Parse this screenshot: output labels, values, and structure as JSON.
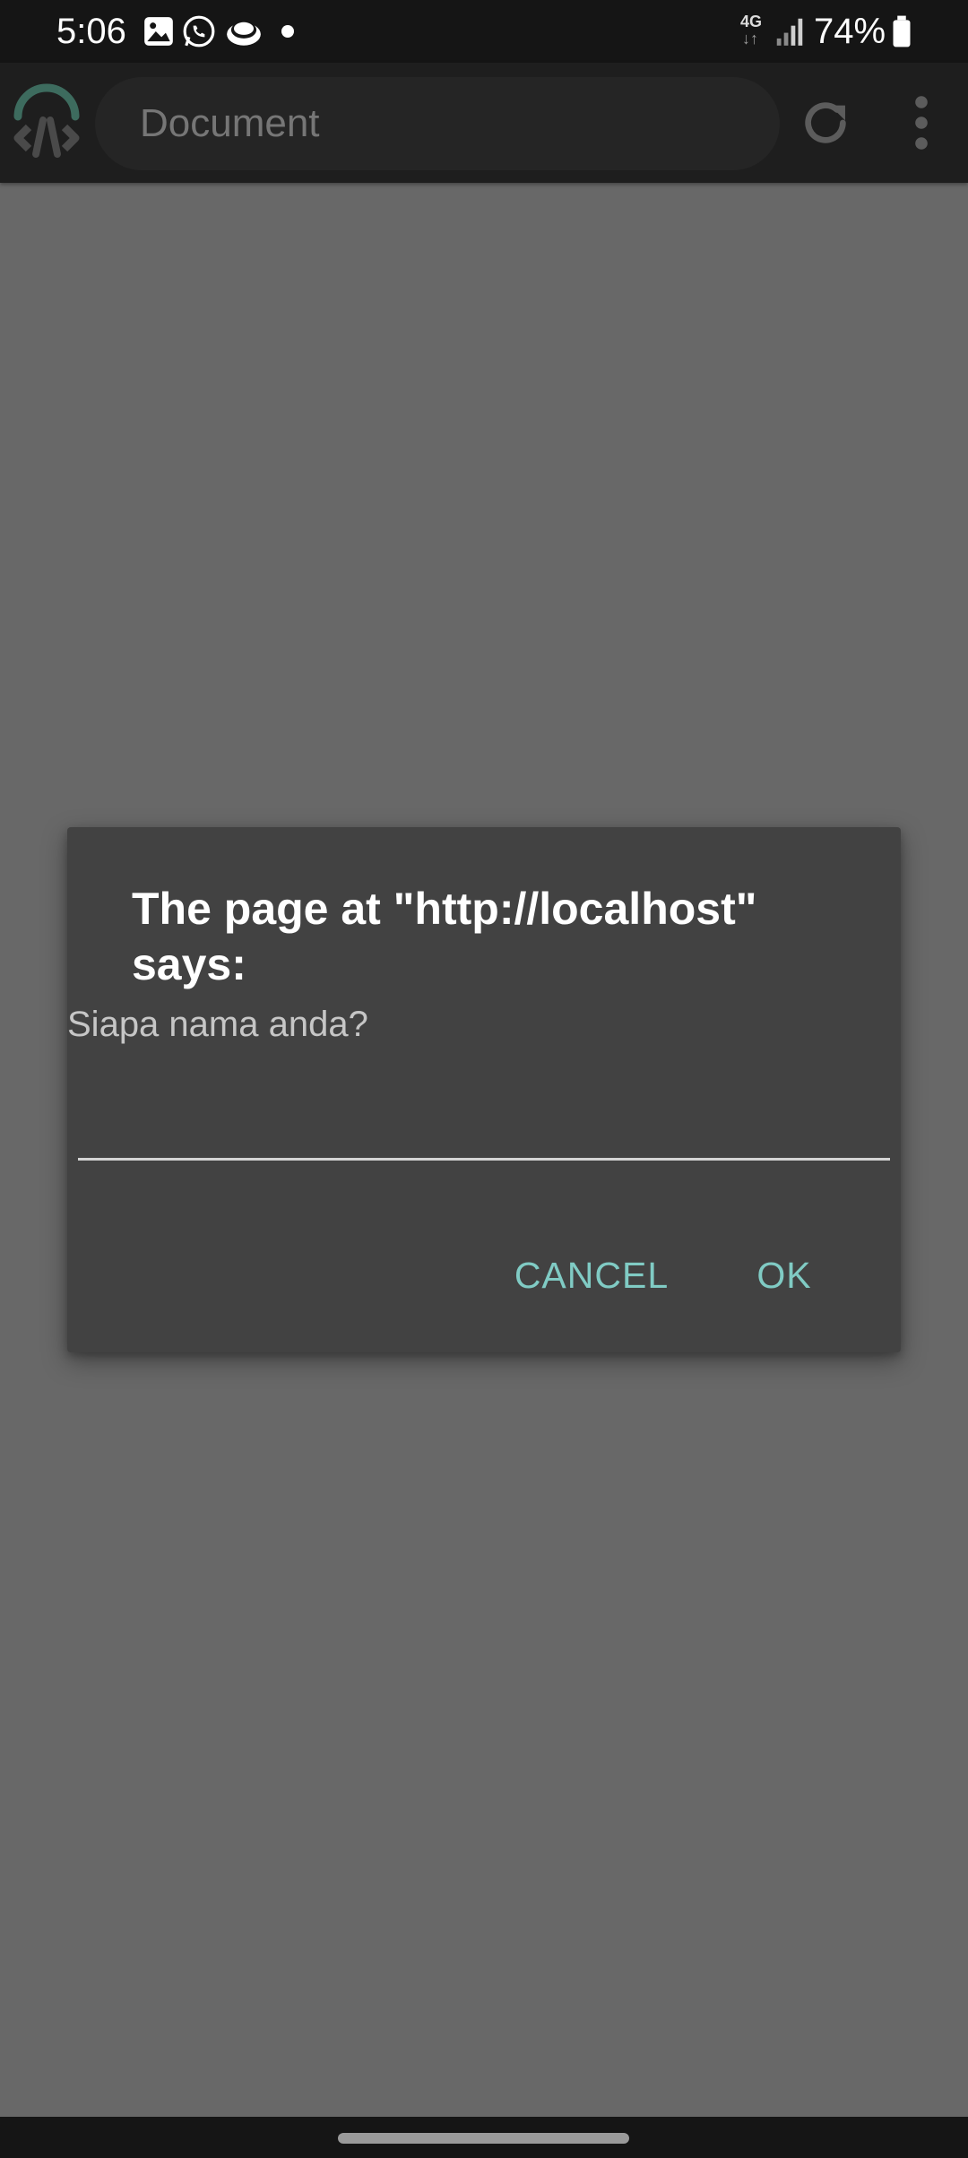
{
  "status_bar": {
    "time": "5:06",
    "network": "4G",
    "network_arrows": "↓↑",
    "battery_percent": "74%",
    "notification_icons": [
      "gallery-icon",
      "whatsapp-icon",
      "cloud-app-icon",
      "more-notifications-dot"
    ],
    "signal_icon": "signal-bars-icon",
    "battery_icon": "battery-icon"
  },
  "toolbar": {
    "url_text": "Document",
    "logo_icon": "app-logo-icon",
    "reload_icon": "reload-icon",
    "menu_icon": "overflow-menu-icon",
    "logo_color": "#3d6b5e"
  },
  "dialog": {
    "title": "The page at \"http://localhost\" says:",
    "message": "Siapa nama anda?",
    "input_value": "",
    "cancel_label": "CANCEL",
    "ok_label": "OK",
    "accent_color": "#80cbc4",
    "background_color": "#424242"
  }
}
